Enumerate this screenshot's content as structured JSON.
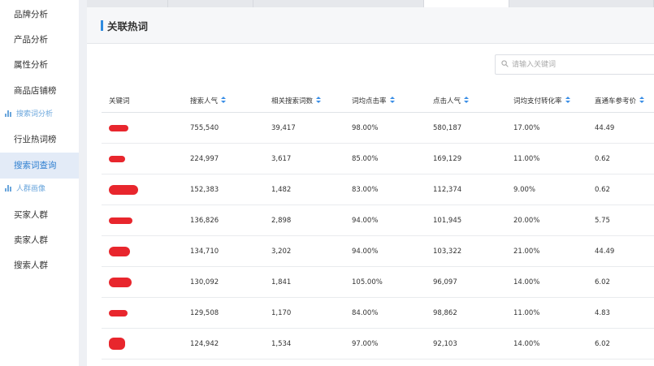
{
  "sidebar": {
    "items": [
      {
        "label": "品牌分析"
      },
      {
        "label": "产品分析"
      },
      {
        "label": "属性分析"
      },
      {
        "label": "商品店铺榜"
      },
      {
        "label": "行业热词榜"
      },
      {
        "label": "搜索词查询"
      },
      {
        "label": "买家人群"
      },
      {
        "label": "卖家人群"
      },
      {
        "label": "搜索人群"
      }
    ],
    "groups": [
      {
        "label": "搜索词分析"
      },
      {
        "label": "人群画像"
      }
    ],
    "active_item": "搜索词查询"
  },
  "panel": {
    "title": "关联热词"
  },
  "search": {
    "placeholder": "请输入关键词",
    "value": ""
  },
  "table": {
    "columns": [
      "关键词",
      "搜索人气",
      "相关搜索词数",
      "词均点击率",
      "点击人气",
      "词均支付转化率",
      "直通车参考价"
    ],
    "rows": [
      {
        "search_popularity": "755,540",
        "related_terms": "39,417",
        "click_rate": "98.00%",
        "click_popularity": "580,187",
        "pay_conversion": "17.00%",
        "ztc_price": "44.49"
      },
      {
        "search_popularity": "224,997",
        "related_terms": "3,617",
        "click_rate": "85.00%",
        "click_popularity": "169,129",
        "pay_conversion": "11.00%",
        "ztc_price": "0.62"
      },
      {
        "search_popularity": "152,383",
        "related_terms": "1,482",
        "click_rate": "83.00%",
        "click_popularity": "112,374",
        "pay_conversion": "9.00%",
        "ztc_price": "0.62"
      },
      {
        "search_popularity": "136,826",
        "related_terms": "2,898",
        "click_rate": "94.00%",
        "click_popularity": "101,945",
        "pay_conversion": "20.00%",
        "ztc_price": "5.75"
      },
      {
        "search_popularity": "134,710",
        "related_terms": "3,202",
        "click_rate": "94.00%",
        "click_popularity": "103,322",
        "pay_conversion": "21.00%",
        "ztc_price": "44.49"
      },
      {
        "search_popularity": "130,092",
        "related_terms": "1,841",
        "click_rate": "105.00%",
        "click_popularity": "96,097",
        "pay_conversion": "14.00%",
        "ztc_price": "6.02"
      },
      {
        "search_popularity": "129,508",
        "related_terms": "1,170",
        "click_rate": "84.00%",
        "click_popularity": "98,862",
        "pay_conversion": "11.00%",
        "ztc_price": "4.83"
      },
      {
        "search_popularity": "124,942",
        "related_terms": "1,534",
        "click_rate": "97.00%",
        "click_popularity": "92,103",
        "pay_conversion": "14.00%",
        "ztc_price": "6.02"
      }
    ]
  },
  "colors": {
    "accent": "#2e8be0",
    "active_bg": "#e3ebf7",
    "redaction": "#e8262d"
  }
}
